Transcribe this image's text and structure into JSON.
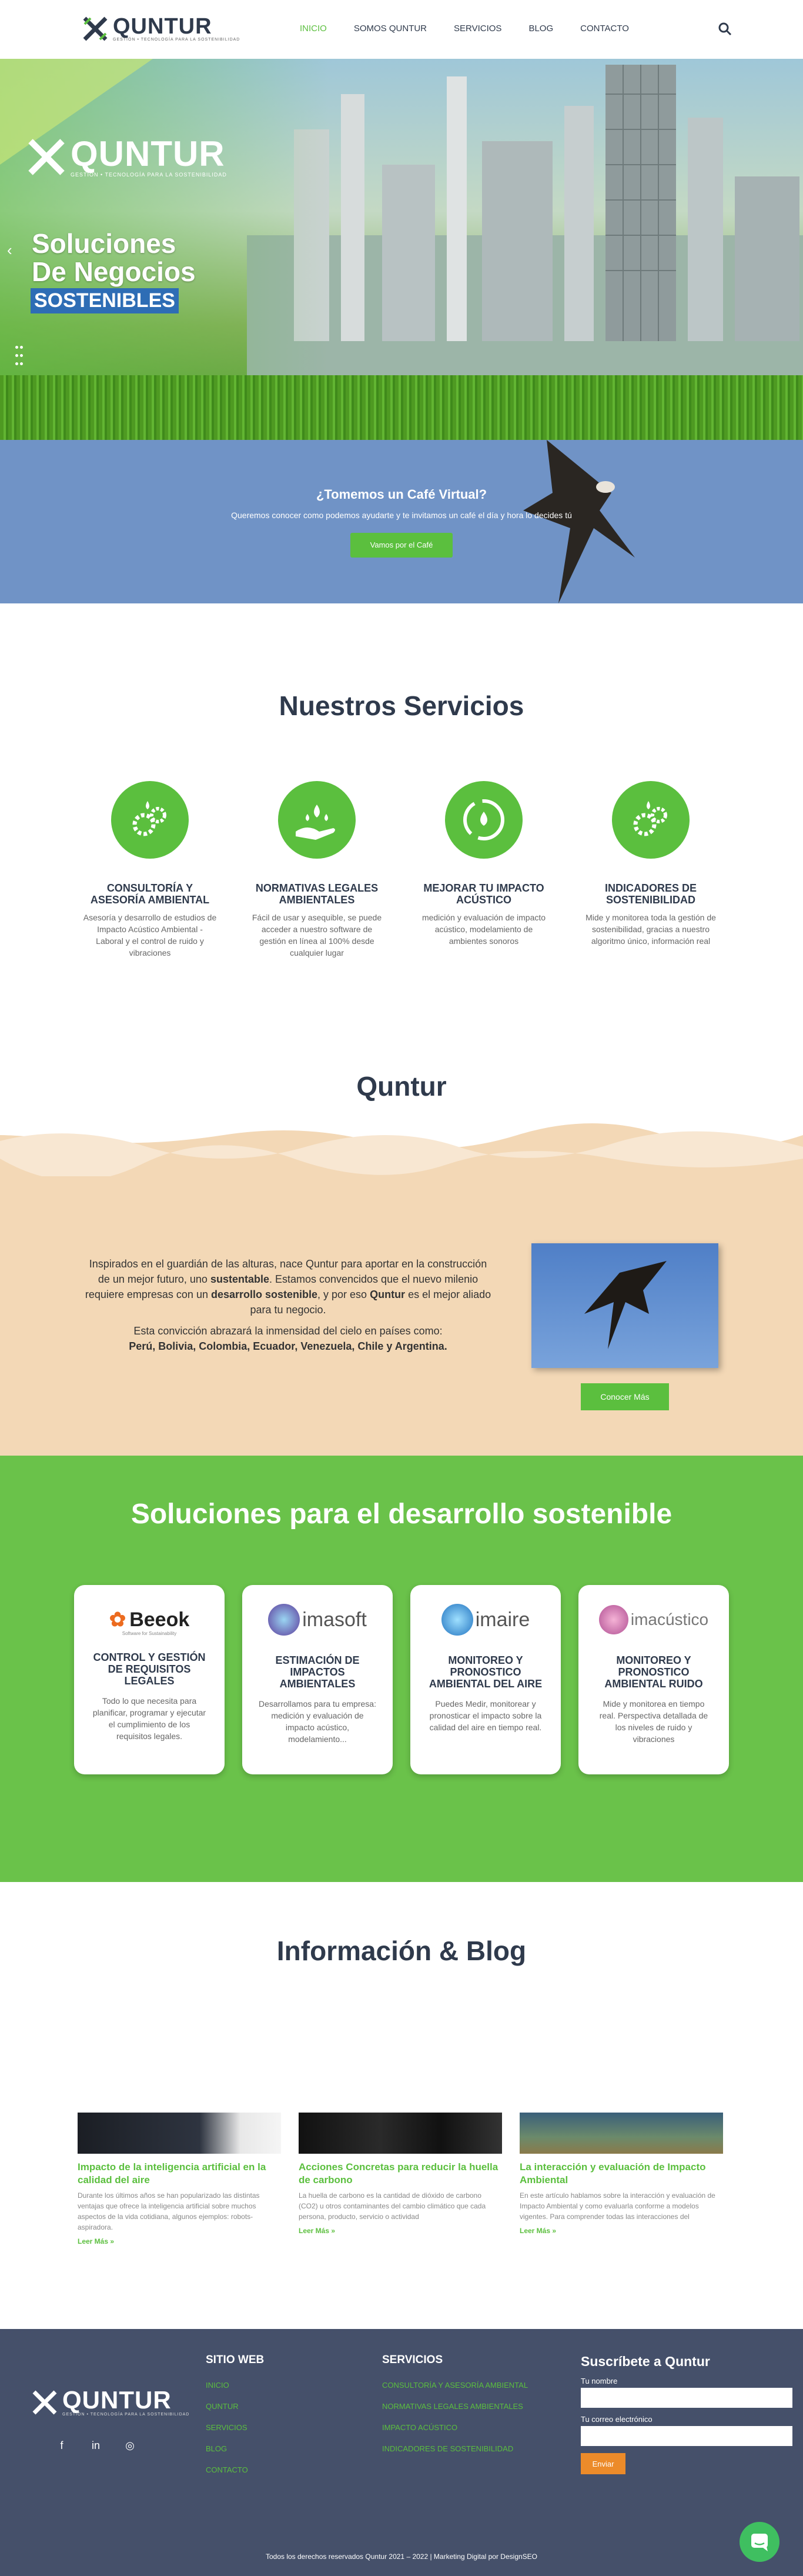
{
  "brand": {
    "name": "QUNTUR",
    "tagline": "GESTIÓN • TECNOLOGÍA PARA LA SOSTENIBILIDAD",
    "colors": {
      "green": "#5bbf3e",
      "navy": "#2f3a4c",
      "blue": "#2e6db5"
    }
  },
  "nav": {
    "items": [
      "INICIO",
      "SOMOS QUNTUR",
      "SERVICIOS",
      "BLOG",
      "CONTACTO"
    ],
    "active": "INICIO",
    "search_icon": "search-icon"
  },
  "hero": {
    "title_line1": "Soluciones",
    "title_line2": "De Negocios",
    "subtitle": "SOSTENIBLES",
    "arrow": "‹"
  },
  "cta": {
    "title": "¿Tomemos un Café Virtual?",
    "text": "Queremos conocer como podemos ayudarte y te invitamos un café el día y hora lo decides tú",
    "button": "Vamos por el Café"
  },
  "services": {
    "title": "Nuestros Servicios",
    "items": [
      {
        "name": "CONSULTORÍA Y ASESORÍA AMBIENTAL",
        "desc": "Asesoría y desarrollo de estudios de Impacto Acústico Ambiental - Laboral y el control de ruido y vibraciones",
        "icon": "gears-drops-icon"
      },
      {
        "name": "NORMATIVAS LEGALES AMBIENTALES",
        "desc": "Fácil de usar y asequible, se puede acceder a nuestro software de gestión en línea al 100% desde cualquier lugar",
        "icon": "hand-drops-icon"
      },
      {
        "name": "MEJORAR TU IMPACTO ACÚSTICO",
        "desc": "medición y evaluación de impacto acústico, modelamiento de ambientes sonoros",
        "icon": "recycle-drop-icon"
      },
      {
        "name": "INDICADORES DE SOSTENIBILIDAD",
        "desc": "Mide y monitorea toda la gestión de sostenibilidad, gracias a nuestro algoritmo único, información real",
        "icon": "gears-drops-icon"
      }
    ]
  },
  "about": {
    "title": "Quntur",
    "p1_a": "Inspirados en el guardián de las alturas, nace Quntur para aportar en la construcción de un mejor futuro, uno ",
    "p1_b": "sustentable",
    "p1_c": ". Estamos convencidos que el nuevo milenio requiere empresas con un ",
    "p1_d": "desarrollo sostenible",
    "p1_e": ", y por eso ",
    "p1_f": "Quntur",
    "p1_g": " es el mejor aliado para tu negocio.",
    "p2": "Esta convicción abrazará la inmensidad del cielo en países como:",
    "p3": "Perú, Bolivia, Colombia, Ecuador, Venezuela, Chile y Argentina.",
    "button": "Conocer Más"
  },
  "solutions": {
    "title": "Soluciones para el desarrollo sostenible",
    "cards": [
      {
        "logo": "Beeok",
        "logo_sub": "Software for Sustainability",
        "title": "CONTROL Y GESTIÓN DE REQUISITOS LEGALES",
        "desc": "Todo lo que necesita para planificar, programar y ejecutar el cumplimiento de los requisitos legales."
      },
      {
        "logo": "imasoft",
        "title": "ESTIMACIÓN DE IMPACTOS AMBIENTALES",
        "desc": "Desarrollamos para tu empresa: medición y evaluación de impacto acústico, modelamiento..."
      },
      {
        "logo": "imaire",
        "title": "MONITOREO Y PRONOSTICO AMBIENTAL DEL AIRE",
        "desc": "Puedes Medir, monitorear y pronosticar el impacto sobre la calidad del aire en tiempo real."
      },
      {
        "logo": "imacústico",
        "title": "MONITOREO Y PRONOSTICO AMBIENTAL RUIDO",
        "desc": "Mide y monitorea en tiempo real. Perspectiva detallada de los niveles de ruido y vibraciones"
      }
    ]
  },
  "blog": {
    "title": "Información & Blog",
    "posts": [
      {
        "title": "Impacto de la inteligencia artificial en la calidad del aire",
        "excerpt": "Durante los últimos años se han popularizado las distintas ventajas que ofrece la inteligencia artificial sobre muchos aspectos de la vida cotidiana, algunos ejemplos: robots-aspiradora.",
        "more": "Leer Más »"
      },
      {
        "title": "Acciones Concretas para reducir la huella de carbono",
        "excerpt": "La huella de carbono es la cantidad de dióxido de carbono (CO2) u otros contaminantes del cambio climático que cada persona, producto, servicio o actividad",
        "more": "Leer Más »"
      },
      {
        "title": "La interacción y evaluación de Impacto Ambiental",
        "excerpt": "En este artículo hablamos sobre la interacción y evaluación de Impacto Ambiental y como evaluarla conforme a modelos vigentes. Para comprender todas las interacciones del",
        "more": "Leer Más »"
      }
    ]
  },
  "footer": {
    "col1_title": "SITIO WEB",
    "col1_links": [
      "INICIO",
      "QUNTUR",
      "SERVICIOS",
      "BLOG",
      "CONTACTO"
    ],
    "col2_title": "SERVICIOS",
    "col2_links": [
      "CONSULTORÍA Y ASESORÍA AMBIENTAL",
      "NORMATIVAS LEGALES AMBIENTALES",
      "IMPACTO ACÚSTICO",
      "INDICADORES DE SOSTENIBILIDAD"
    ],
    "form_title": "Suscríbete a Quntur",
    "name_label": "Tu nombre",
    "email_label": "Tu correo electrónico",
    "submit": "Enviar",
    "social": [
      "f",
      "in",
      "◎"
    ],
    "copyright": "Todos los derechos reservados Quntur 2021 – 2022 | Marketing Digital por DesignSEO"
  }
}
